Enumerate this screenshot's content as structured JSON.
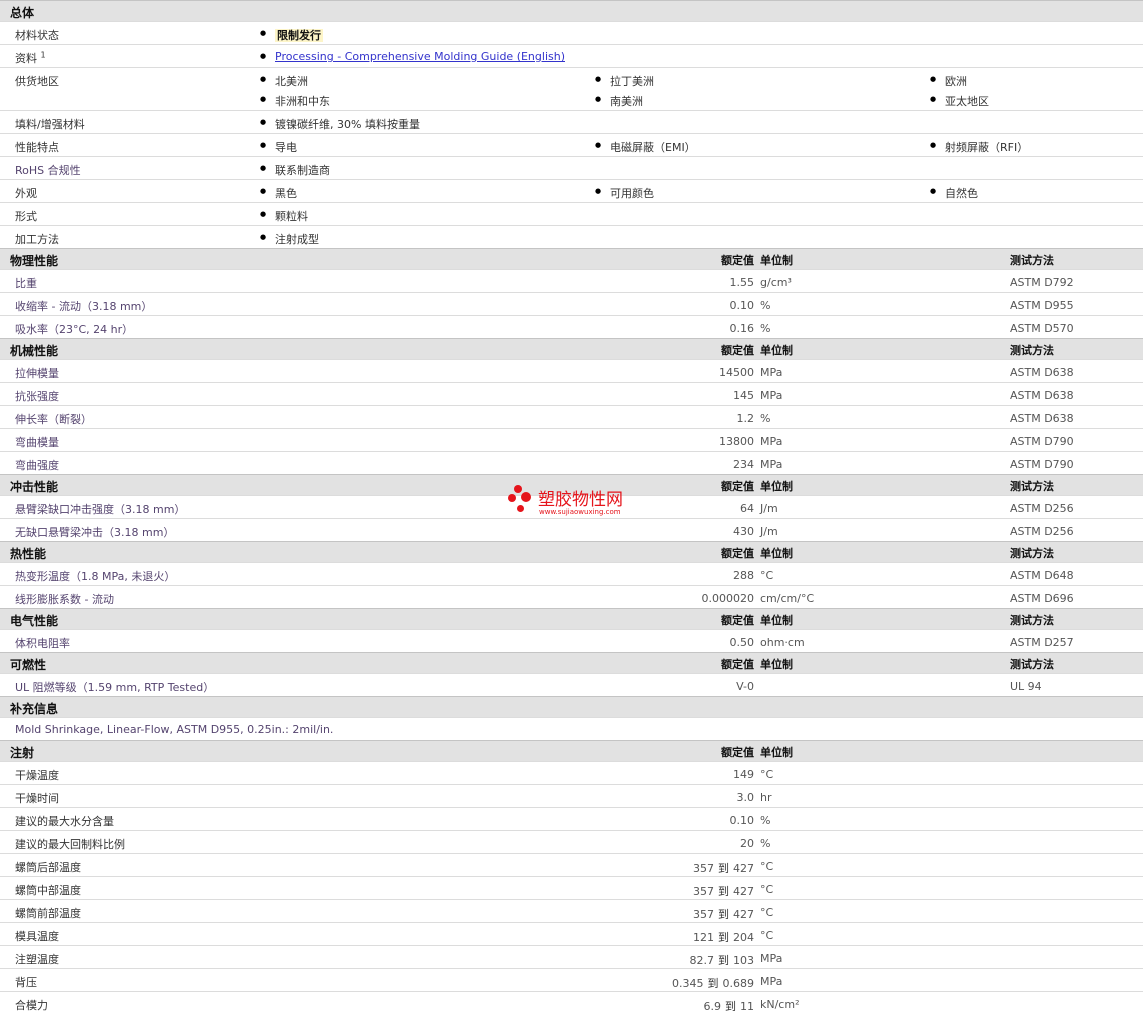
{
  "overview": {
    "title": "总体",
    "material_status": {
      "label": "材料状态",
      "value": "限制发行"
    },
    "resources": {
      "label": "资料",
      "sup": "1",
      "link": "Processing - Comprehensive Molding Guide (English)"
    },
    "regions": {
      "label": "供货地区",
      "items": [
        "北美洲",
        "拉丁美洲",
        "欧洲",
        "非洲和中东",
        "南美洲",
        "亚太地区"
      ]
    },
    "filler": {
      "label": "填料/增强材料",
      "value": "镀镍碳纤维, 30% 填料按重量"
    },
    "features": {
      "label": "性能特点",
      "items": [
        "导电",
        "电磁屏蔽（EMI）",
        "射频屏蔽（RFI）"
      ]
    },
    "rohs": {
      "label": "RoHS 合规性",
      "value": "联系制造商"
    },
    "appearance": {
      "label": "外观",
      "items": [
        "黑色",
        "可用颜色",
        "自然色"
      ]
    },
    "form": {
      "label": "形式",
      "value": "颗粒料"
    },
    "processing": {
      "label": "加工方法",
      "value": "注射成型"
    }
  },
  "header_labels": {
    "value": "额定值",
    "unit": "单位制",
    "method": "测试方法"
  },
  "sections": [
    {
      "title": "物理性能",
      "rows": [
        {
          "label": "比重",
          "value": "1.55",
          "unit": "g/cm³",
          "method": "ASTM D792"
        },
        {
          "label": "收缩率  - 流动（3.18 mm）",
          "value": "0.10",
          "unit": "%",
          "method": "ASTM D955"
        },
        {
          "label": "吸水率（23°C, 24 hr）",
          "value": "0.16",
          "unit": "%",
          "method": "ASTM D570"
        }
      ]
    },
    {
      "title": "机械性能",
      "rows": [
        {
          "label": "拉伸模量",
          "value": "14500",
          "unit": "MPa",
          "method": "ASTM D638"
        },
        {
          "label": "抗张强度",
          "value": "145",
          "unit": "MPa",
          "method": "ASTM D638"
        },
        {
          "label": "伸长率（断裂）",
          "value": "1.2",
          "unit": "%",
          "method": "ASTM D638"
        },
        {
          "label": "弯曲模量",
          "value": "13800",
          "unit": "MPa",
          "method": "ASTM D790"
        },
        {
          "label": "弯曲强度",
          "value": "234",
          "unit": "MPa",
          "method": "ASTM D790"
        }
      ]
    },
    {
      "title": "冲击性能",
      "rows": [
        {
          "label": "悬臂梁缺口冲击强度（3.18 mm）",
          "value": "64",
          "unit": "J/m",
          "method": "ASTM D256"
        },
        {
          "label": "无缺口悬臂梁冲击（3.18 mm）",
          "value": "430",
          "unit": "J/m",
          "method": "ASTM D256"
        }
      ]
    },
    {
      "title": "热性能",
      "rows": [
        {
          "label": "热变形温度（1.8 MPa, 未退火）",
          "value": "288",
          "unit": "°C",
          "method": "ASTM D648"
        },
        {
          "label": "线形膨胀系数  - 流动",
          "value": "0.000020",
          "unit": "cm/cm/°C",
          "method": "ASTM D696"
        }
      ]
    },
    {
      "title": "电气性能",
      "rows": [
        {
          "label": "体积电阻率",
          "value": "0.50",
          "unit": "ohm·cm",
          "method": "ASTM D257"
        }
      ]
    },
    {
      "title": "可燃性",
      "rows": [
        {
          "label": "UL 阻燃等级（1.59 mm, RTP Tested）",
          "value": "V-0",
          "unit": "",
          "method": "UL 94"
        }
      ]
    }
  ],
  "supplement": {
    "title": "补充信息",
    "note": "Mold Shrinkage, Linear-Flow, ASTM D955, 0.25in.: 2mil/in."
  },
  "injection": {
    "title": "注射",
    "rows": [
      {
        "label": "干燥温度",
        "value": "149",
        "unit": "°C"
      },
      {
        "label": "干燥时间",
        "value": "3.0",
        "unit": "hr"
      },
      {
        "label": "建议的最大水分含量",
        "value": "0.10",
        "unit": "%"
      },
      {
        "label": "建议的最大回制料比例",
        "value": "20",
        "unit": "%"
      },
      {
        "label": "螺筒后部温度",
        "lo": "357",
        "to": "到",
        "hi": "427",
        "unit": "°C"
      },
      {
        "label": "螺筒中部温度",
        "lo": "357",
        "to": "到",
        "hi": "427",
        "unit": "°C"
      },
      {
        "label": "螺筒前部温度",
        "lo": "357",
        "to": "到",
        "hi": "427",
        "unit": "°C"
      },
      {
        "label": "模具温度",
        "lo": "121",
        "to": "到",
        "hi": "204",
        "unit": "°C"
      },
      {
        "label": "注塑温度",
        "lo": "82.7",
        "to": "到",
        "hi": "103",
        "unit": "MPa"
      },
      {
        "label": "背压",
        "lo": "0.345",
        "to": "到",
        "hi": "0.689",
        "unit": "MPa"
      },
      {
        "label": "合模力",
        "lo": "6.9",
        "to": "到",
        "hi": "11",
        "unit": "kN/cm²"
      }
    ]
  },
  "watermark": {
    "text": "塑胶物性网",
    "url": "www.sujiaowuxing.com"
  },
  "colors": {
    "section_bg": "#e2e2e2",
    "highlight_bg": "#fdf5c8",
    "link": "#3333cc",
    "label_purple": "#55446f",
    "watermark": "#e5141b"
  }
}
